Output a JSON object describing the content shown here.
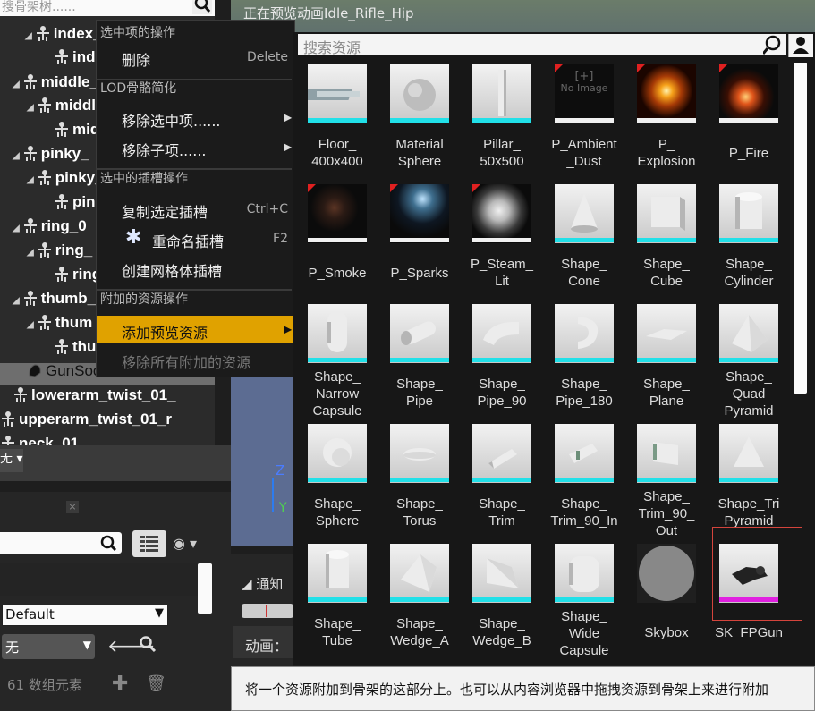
{
  "viewport": {
    "title": "正在预览动画Idle_Rifle_Hip",
    "axis_z": "Z",
    "axis_y": "Y"
  },
  "skeleton_tree": {
    "search_placeholder": "搜骨架树......",
    "rows": [
      {
        "label": "index_"
      },
      {
        "label": "index_"
      },
      {
        "label": "middle_"
      },
      {
        "label": "middle_"
      },
      {
        "label": "middle_"
      },
      {
        "label": "pinky_"
      },
      {
        "label": "pinky_"
      },
      {
        "label": "pinky_"
      },
      {
        "label": "ring_0"
      },
      {
        "label": "ring_"
      },
      {
        "label": "ring_"
      },
      {
        "label": "thumb_"
      },
      {
        "label": "thum"
      },
      {
        "label": "thum"
      },
      {
        "label": "GunSocket"
      },
      {
        "label": "lowerarm_twist_01_"
      },
      {
        "label": "upperarm_twist_01_r"
      },
      {
        "label": "neck_01"
      }
    ]
  },
  "left_panel": {
    "toolbar_dropdown": "无",
    "default_select": "Default",
    "none_select": "无",
    "array_count": "61 数组元素"
  },
  "notifications": {
    "tab": "通知",
    "anim_label": "动画："
  },
  "context_menu": {
    "sections": [
      {
        "header": "选中项的操作",
        "items": [
          {
            "label": "删除",
            "shortcut": "Delete"
          }
        ]
      },
      {
        "header": "LOD骨骼简化",
        "items": [
          {
            "label": "移除选中项......",
            "submenu": true
          },
          {
            "label": "移除子项......",
            "submenu": true
          }
        ]
      },
      {
        "header": "选中的插槽操作",
        "items": [
          {
            "label": "复制选定插槽",
            "shortcut": "Ctrl+C"
          },
          {
            "label": "重命名插槽",
            "shortcut": "F2"
          },
          {
            "label": "创建网格体插槽"
          }
        ]
      },
      {
        "header": "附加的资源操作",
        "items": [
          {
            "label": "添加预览资源",
            "submenu": true,
            "highlighted": true
          },
          {
            "label": "移除所有附加的资源",
            "disabled": true
          }
        ]
      }
    ]
  },
  "asset_picker": {
    "search_placeholder": "搜索资源",
    "accent_cyan": "#21e0e8",
    "accent_white": "#f0f0f0",
    "accent_magenta": "#e020e0",
    "assets": [
      {
        "label": "Floor_\n400x400",
        "kind": "floor",
        "bar": "cyan"
      },
      {
        "label": "Material\nSphere",
        "kind": "sphere",
        "bar": "cyan"
      },
      {
        "label": "Pillar_\n50x500",
        "kind": "pillar",
        "bar": "cyan"
      },
      {
        "label": "P_Ambient\n_Dust",
        "kind": "noimage",
        "bar": "white",
        "noimage": "No Image"
      },
      {
        "label": "P_\nExplosion",
        "kind": "explosion",
        "bar": "white"
      },
      {
        "label": "P_Fire",
        "kind": "fire",
        "bar": "white"
      },
      {
        "label": "P_Smoke",
        "kind": "smoke",
        "bar": "white"
      },
      {
        "label": "P_Sparks",
        "kind": "sparks",
        "bar": "white"
      },
      {
        "label": "P_Steam_\nLit",
        "kind": "steam",
        "bar": "white"
      },
      {
        "label": "Shape_\nCone",
        "kind": "cone",
        "bar": "cyan"
      },
      {
        "label": "Shape_\nCube",
        "kind": "cube",
        "bar": "cyan"
      },
      {
        "label": "Shape_\nCylinder",
        "kind": "cylinder",
        "bar": "cyan"
      },
      {
        "label": "Shape_\nNarrow\nCapsule",
        "kind": "capsule",
        "bar": "cyan"
      },
      {
        "label": "Shape_\nPipe",
        "kind": "pipe",
        "bar": "cyan"
      },
      {
        "label": "Shape_\nPipe_90",
        "kind": "pipe90",
        "bar": "cyan"
      },
      {
        "label": "Shape_\nPipe_180",
        "kind": "pipe180",
        "bar": "cyan"
      },
      {
        "label": "Shape_\nPlane",
        "kind": "plane",
        "bar": "cyan"
      },
      {
        "label": "Shape_\nQuad\nPyramid",
        "kind": "pyramid",
        "bar": "cyan"
      },
      {
        "label": "Shape_\nSphere",
        "kind": "sphere2",
        "bar": "cyan"
      },
      {
        "label": "Shape_\nTorus",
        "kind": "torus",
        "bar": "cyan"
      },
      {
        "label": "Shape_\nTrim",
        "kind": "trim",
        "bar": "cyan"
      },
      {
        "label": "Shape_\nTrim_90_In",
        "kind": "trim90in",
        "bar": "cyan"
      },
      {
        "label": "Shape_\nTrim_90_\nOut",
        "kind": "trim90out",
        "bar": "cyan"
      },
      {
        "label": "Shape_Tri\nPyramid",
        "kind": "tripyramid",
        "bar": "cyan"
      },
      {
        "label": "Shape_\nTube",
        "kind": "tube",
        "bar": "cyan"
      },
      {
        "label": "Shape_\nWedge_A",
        "kind": "wedgea",
        "bar": "cyan"
      },
      {
        "label": "Shape_\nWedge_B",
        "kind": "wedgeb",
        "bar": "cyan"
      },
      {
        "label": "Shape_\nWide\nCapsule",
        "kind": "widecapsule",
        "bar": "cyan"
      },
      {
        "label": "Skybox",
        "kind": "skybox",
        "bar": "none"
      },
      {
        "label": "SK_FPGun",
        "kind": "gun",
        "bar": "magenta",
        "highlighted": true
      }
    ]
  },
  "tooltip": {
    "text": "将一个资源附加到骨架的这部分上。也可以从内容浏览器中拖拽资源到骨架上来进行附加"
  }
}
